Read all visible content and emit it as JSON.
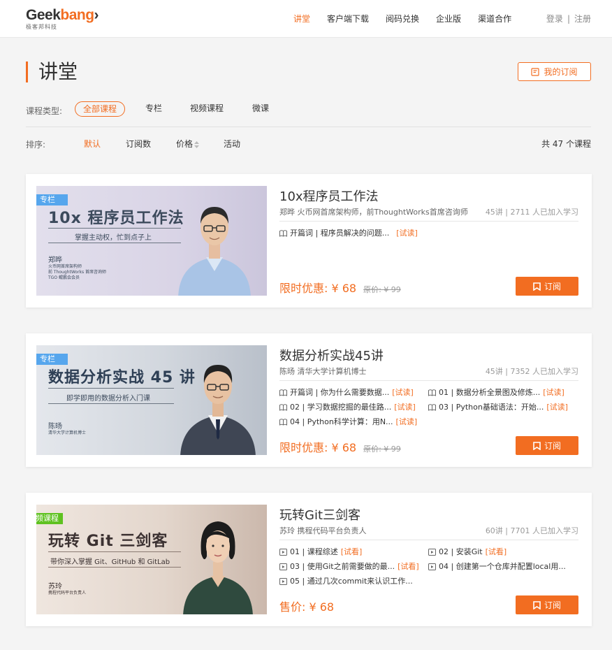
{
  "brand": {
    "logo_text": "Geekbang",
    "logo_sub": "极客邦科技"
  },
  "nav": [
    {
      "label": "讲堂",
      "active": true
    },
    {
      "label": "客户端下载"
    },
    {
      "label": "阅码兑换"
    },
    {
      "label": "企业版"
    },
    {
      "label": "渠道合作"
    }
  ],
  "auth": {
    "login": "登录",
    "sep": "|",
    "register": "注册"
  },
  "page": {
    "title": "讲堂",
    "my_subscriptions": "我的订阅"
  },
  "filters": {
    "type_label": "课程类型:",
    "types": [
      "全部课程",
      "专栏",
      "视频课程",
      "微课"
    ],
    "sort_label": "排序:",
    "sorts": [
      "默认",
      "订阅数",
      "价格",
      "活动"
    ],
    "total": "共 47 个课程"
  },
  "courses": [
    {
      "tag": "专栏",
      "cover_title": "10x 程序员工作法",
      "cover_sub": "掌握主动权，忙到点子上",
      "cover_name": "郑晔",
      "cover_role": [
        "火币网首席架构师",
        "前 ThoughtWorks 首席咨询师",
        "TGO 鲲鹏会会员"
      ],
      "title": "10x程序员工作法",
      "author": "郑晔  火币网首席架构师，前ThoughtWorks首席咨询师",
      "stats": "45讲 | 2711 人已加入学习",
      "lessons": [
        {
          "text": "开篇词 | 程序员解决的问题...",
          "try": "[试读]"
        }
      ],
      "price": "限时优惠: ¥ 68",
      "orig": "原价: ¥ 99",
      "buy": "订阅"
    },
    {
      "tag": "专栏",
      "cover_title": "数据分析实战 45 讲",
      "cover_sub": "即学即用的数据分析入门课",
      "cover_name": "陈旸",
      "cover_role": [
        "清华大学计算机博士"
      ],
      "title": "数据分析实战45讲",
      "author": "陈旸  清华大学计算机博士",
      "stats": "45讲 | 7352 人已加入学习",
      "lessons": [
        {
          "text": "开篇词 | 你为什么需要数据...",
          "try": "[试读]"
        },
        {
          "text": "01 | 数据分析全景图及修炼...",
          "try": "[试读]"
        },
        {
          "text": "02 | 学习数据挖掘的最佳路...",
          "try": "[试读]"
        },
        {
          "text": "03 | Python基础语法：开始...",
          "try": "[试读]"
        },
        {
          "text": "04 | Python科学计算：用N...",
          "try": "[试读]"
        }
      ],
      "price": "限时优惠: ¥ 68",
      "orig": "原价: ¥ 99",
      "buy": "订阅"
    },
    {
      "tag": "视频课程",
      "cover_title": "玩转 Git 三剑客",
      "cover_sub": "带你深入掌握 Git、GitHub 和 GitLab",
      "cover_name": "苏玲",
      "cover_role": [
        "携程代码平台负责人"
      ],
      "title": "玩转Git三剑客",
      "author": "苏玲  携程代码平台负责人",
      "stats": "60讲 | 7701 人已加入学习",
      "lessons": [
        {
          "text": "01 | 课程综述",
          "try": "[试看]"
        },
        {
          "text": "02 | 安装Git",
          "try": "[试看]"
        },
        {
          "text": "03 | 使用Git之前需要做的最...",
          "try": "[试看]"
        },
        {
          "text": "04 | 创建第一个仓库并配置local用...",
          "try": ""
        },
        {
          "text": "05 | 通过几次commit来认识工作...",
          "try": ""
        }
      ],
      "price": "售价: ¥ 68",
      "orig": "",
      "buy": "订阅"
    }
  ],
  "colors": {
    "accent": "#f26d21",
    "tag_blue": "#56a6ed",
    "tag_green": "#5fc221"
  }
}
